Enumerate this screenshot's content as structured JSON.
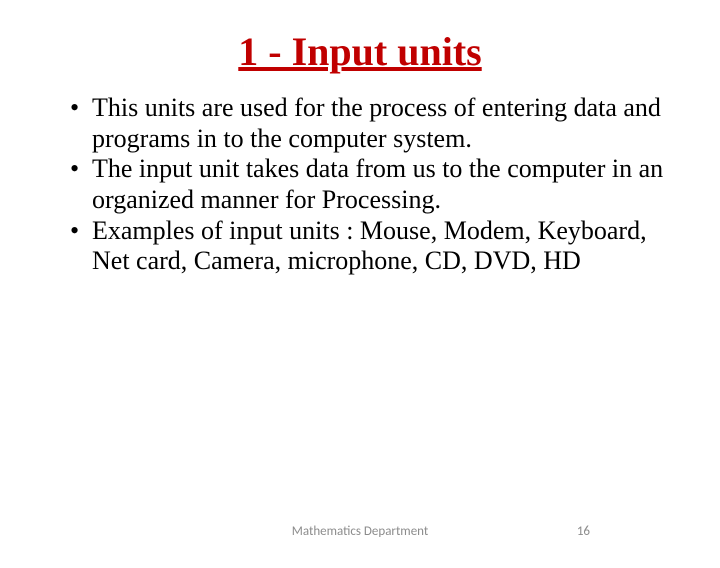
{
  "title": "1 - Input units",
  "bullets": [
    "This units are used for  the process of entering data and programs in to the computer system.",
    "The input unit takes data from us to the computer in an organized manner for Processing.",
    "Examples of input units : Mouse, Modem, Keyboard, Net card, Camera, microphone, CD, DVD, HD"
  ],
  "footer": {
    "department": "Mathematics Department",
    "page_number": "16"
  }
}
